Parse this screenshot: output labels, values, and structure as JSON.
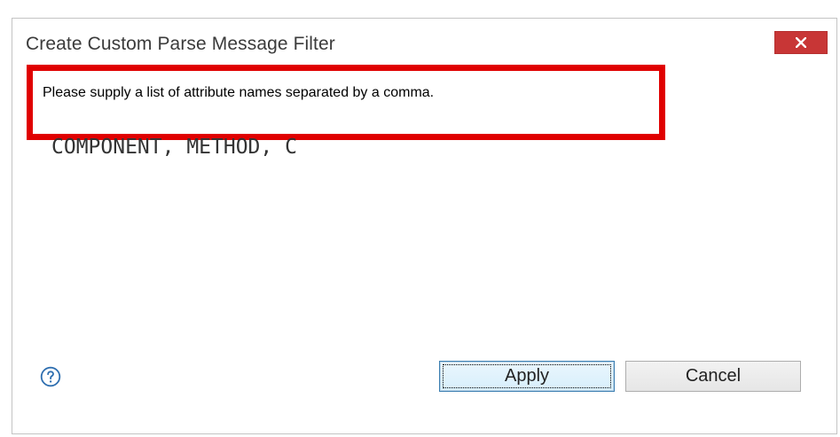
{
  "window": {
    "title": "Create Custom Parse Message Filter",
    "close_label": "×"
  },
  "message": {
    "text": "Please supply a list of attribute names separated by a comma."
  },
  "input": {
    "value": "COMPONENT, METHOD, C"
  },
  "buttons": {
    "apply_label": "Apply",
    "cancel_label": "Cancel"
  },
  "icons": {
    "help": "help-icon",
    "close": "close-icon"
  },
  "colors": {
    "close_bg": "#c83636",
    "highlight_border": "#e00000",
    "focus_border": "#3c7fb1"
  }
}
